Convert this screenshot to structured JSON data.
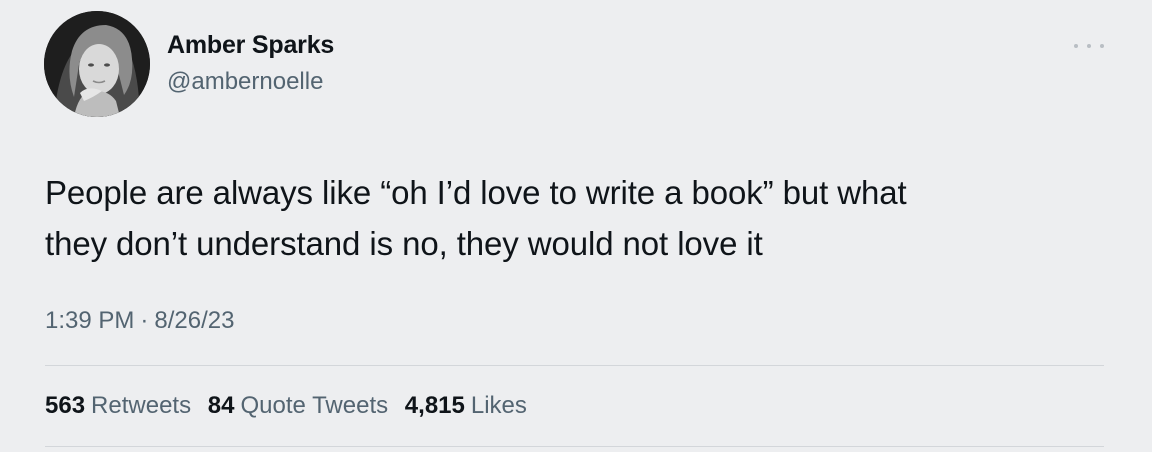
{
  "author": {
    "display_name": "Amber Sparks",
    "handle": "@ambernoelle",
    "avatar_icon": "profile-photo-avatar"
  },
  "more_icon": "ellipsis-icon",
  "tweet": {
    "lines": [
      "People are always like “oh I’d love to write a book” but what",
      "they don’t understand is no, they would not love it"
    ]
  },
  "meta": {
    "time": "1:39 PM",
    "separator": "·",
    "date": "8/26/23"
  },
  "stats": {
    "retweets_count": "563",
    "retweets_label": "Retweets",
    "quotes_count": "84",
    "quotes_label": "Quote Tweets",
    "likes_count": "4,815",
    "likes_label": "Likes"
  },
  "colors": {
    "background": "#edeef0",
    "text_primary": "#0f1419",
    "text_secondary": "#536471",
    "divider": "#d3d6da"
  }
}
